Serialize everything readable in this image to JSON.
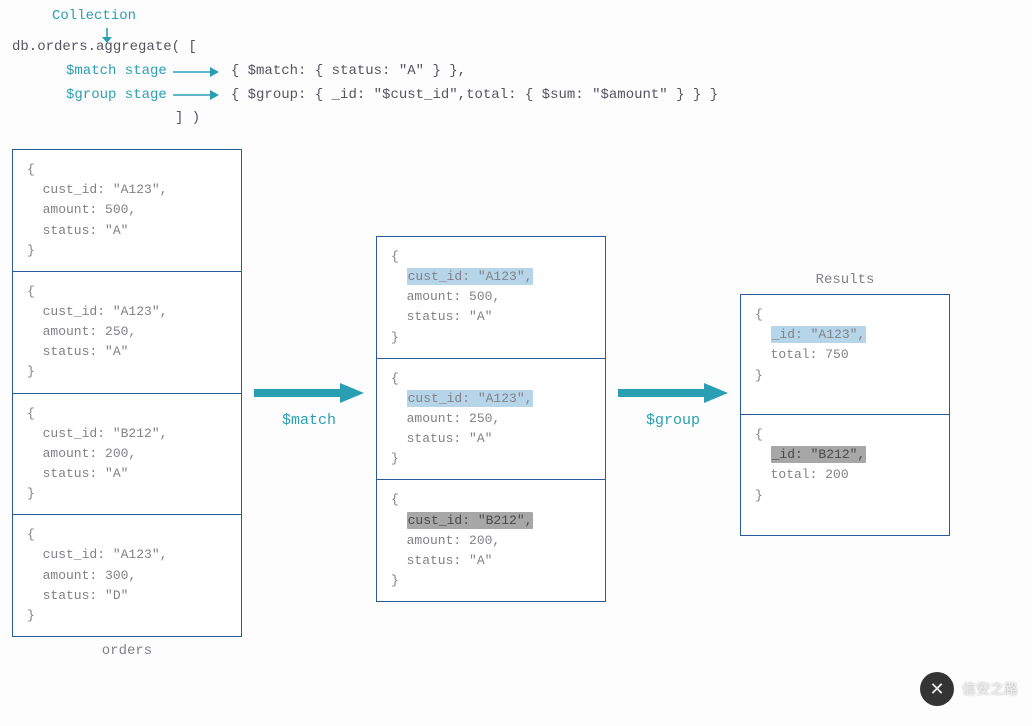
{
  "header": {
    "collection_label": "Collection",
    "line1": "db.orders.aggregate( [",
    "match_stage_label": "$match stage",
    "group_stage_label": "$group stage",
    "match_expr": "{ $match: { status: \"A\" } },",
    "group_expr": "{ $group: { _id: \"$cust_id\",total: { $sum: \"$amount\" } } }",
    "line_close": "] )"
  },
  "orders_label": "orders",
  "results_label": "Results",
  "arrow_match": "$match",
  "arrow_group": "$group",
  "orders_docs": [
    {
      "lines": [
        "{",
        "  cust_id: \"A123\",",
        "  amount: 500,",
        "  status: \"A\"",
        "}"
      ],
      "hl": null
    },
    {
      "lines": [
        "{",
        "  cust_id: \"A123\",",
        "  amount: 250,",
        "  status: \"A\"",
        "}"
      ],
      "hl": null
    },
    {
      "lines": [
        "{",
        "  cust_id: \"B212\",",
        "  amount: 200,",
        "  status: \"A\"",
        "}"
      ],
      "hl": null
    },
    {
      "lines": [
        "{",
        "  cust_id: \"A123\",",
        "  amount: 300,",
        "  status: \"D\"",
        "}"
      ],
      "hl": null
    }
  ],
  "matched_docs": [
    {
      "pre": "{",
      "hl_text": "cust_id: \"A123\",",
      "rest": [
        "  amount: 500,",
        "  status: \"A\"",
        "}"
      ],
      "hl_class": "hl-blue"
    },
    {
      "pre": "{",
      "hl_text": "cust_id: \"A123\",",
      "rest": [
        "  amount: 250,",
        "  status: \"A\"",
        "}"
      ],
      "hl_class": "hl-blue"
    },
    {
      "pre": "{",
      "hl_text": "cust_id: \"B212\",",
      "rest": [
        "  amount: 200,",
        "  status: \"A\"",
        "}"
      ],
      "hl_class": "hl-gray"
    }
  ],
  "result_docs": [
    {
      "pre": "{",
      "hl_text": "_id: \"A123\",",
      "rest": [
        "  total: 750",
        "}"
      ],
      "hl_class": "hl-blue"
    },
    {
      "pre": "{",
      "hl_text": "_id: \"B212\",",
      "rest": [
        "  total: 200",
        "}"
      ],
      "hl_class": "hl-gray"
    }
  ],
  "watermark": "信安之路"
}
